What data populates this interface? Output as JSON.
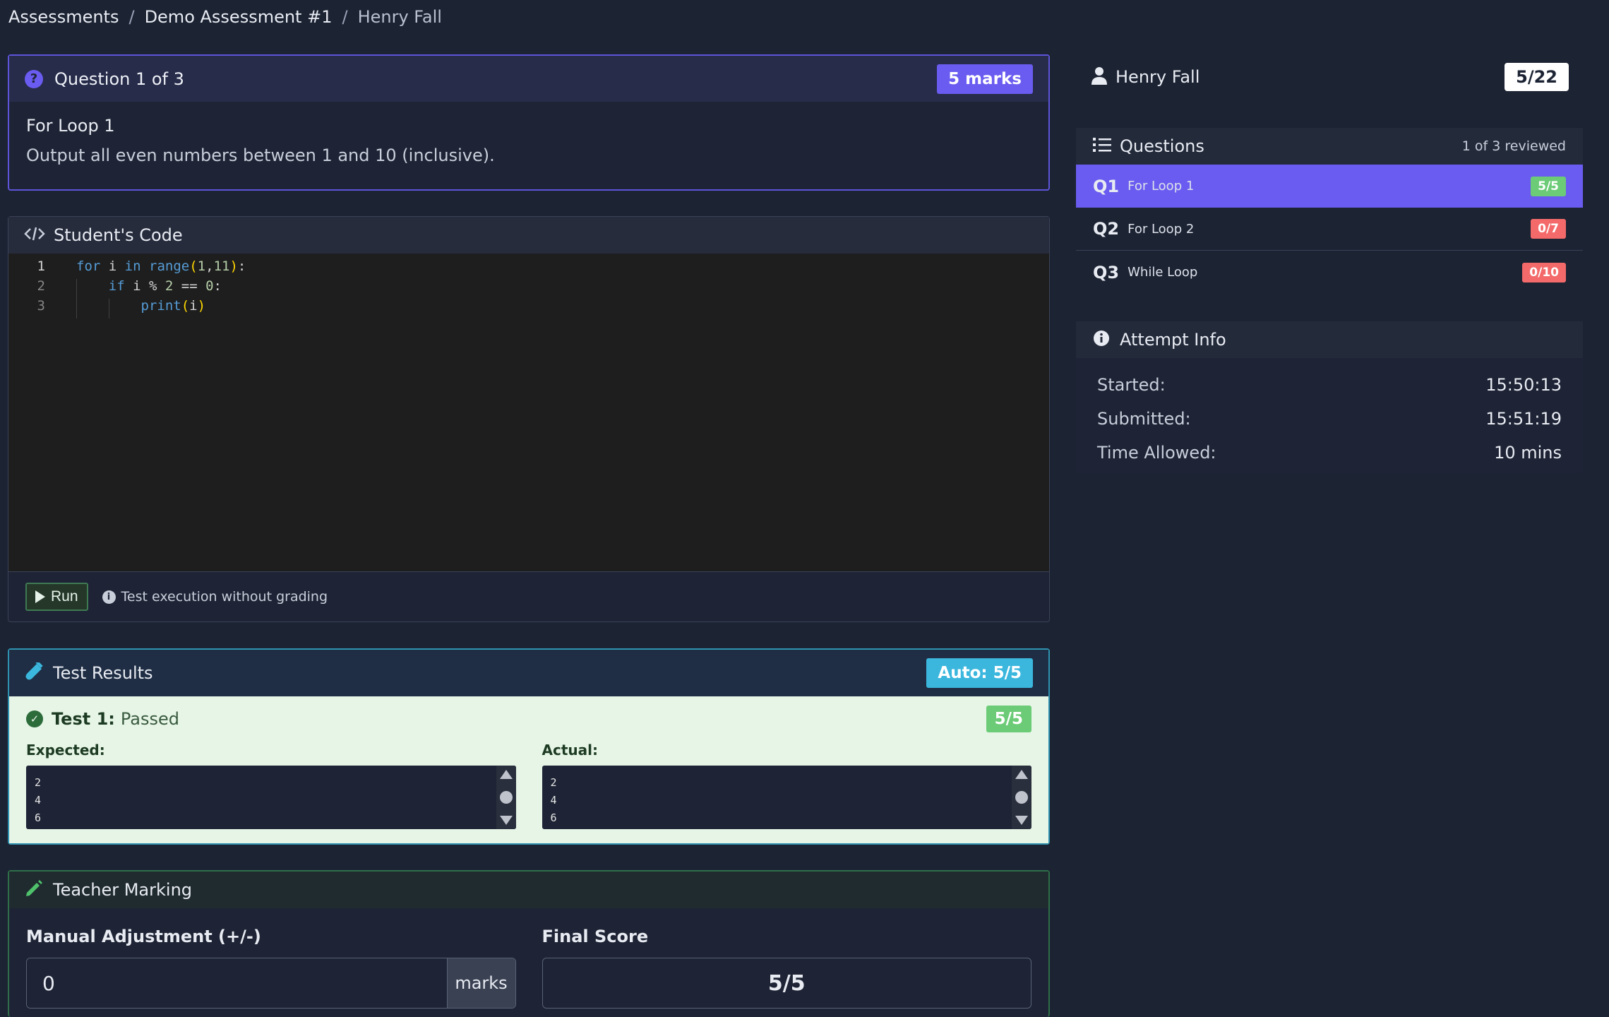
{
  "breadcrumb": {
    "items": [
      "Assessments",
      "Demo Assessment #1",
      "Henry Fall"
    ],
    "separator": "/"
  },
  "question": {
    "header": "Question 1 of 3",
    "marks": "5 marks",
    "name": "For Loop 1",
    "text": "Output all even numbers between 1 and 10 (inclusive).",
    "icon": "question-circle-icon"
  },
  "code_panel": {
    "title": "Student's Code",
    "icon": "code-icon",
    "lines": [
      "1",
      "2",
      "3"
    ],
    "run_label": "Run",
    "hint": "Test execution without grading"
  },
  "test_results": {
    "title": "Test Results",
    "auto_score": "Auto: 5/5",
    "test_label": "Test 1:",
    "test_status": "Passed",
    "test_score": "5/5",
    "expected_label": "Expected:",
    "actual_label": "Actual:",
    "expected": [
      "2",
      "4",
      "6"
    ],
    "actual": [
      "2",
      "4",
      "6"
    ]
  },
  "teacher_marking": {
    "title": "Teacher Marking",
    "adjustment_label": "Manual Adjustment (+/-)",
    "adjustment_value": "0",
    "unit": "marks",
    "final_label": "Final Score",
    "final_value": "5/5"
  },
  "sidebar": {
    "student_name": "Henry Fall",
    "total_score": "5/22",
    "questions_title": "Questions",
    "reviewed": "1 of 3 reviewed",
    "items": [
      {
        "num": "Q1",
        "name": "For Loop 1",
        "score": "5/5",
        "color": "#6bcb77"
      },
      {
        "num": "Q2",
        "name": "For Loop 2",
        "score": "0/7",
        "color": "#f46a6a"
      },
      {
        "num": "Q3",
        "name": "While Loop",
        "score": "0/10",
        "color": "#f46a6a"
      }
    ],
    "attempt_title": "Attempt Info",
    "attempt": [
      {
        "label": "Started:",
        "value": "15:50:13"
      },
      {
        "label": "Submitted:",
        "value": "15:51:19"
      },
      {
        "label": "Time Allowed:",
        "value": "10 mins"
      }
    ]
  },
  "colors": {
    "accent": "#6a5cf0",
    "info": "#3bb7de",
    "success": "#6bcb77",
    "danger": "#f46a6a",
    "background": "#1c2333"
  }
}
